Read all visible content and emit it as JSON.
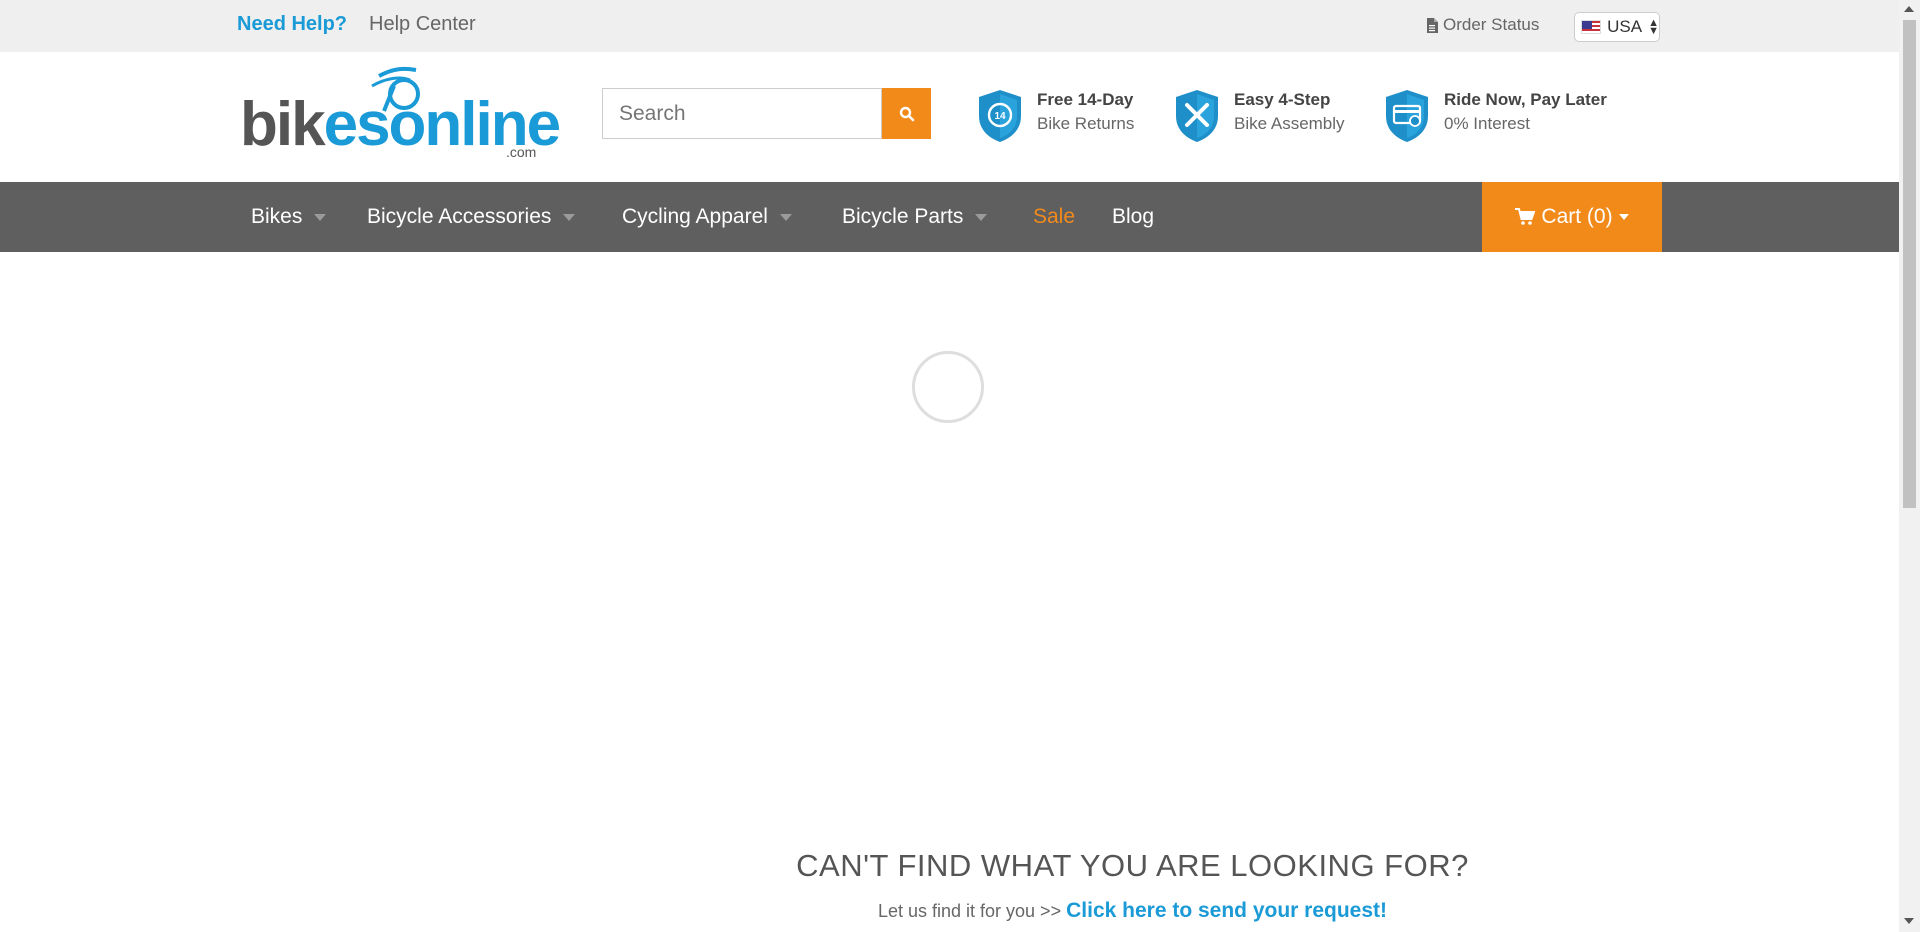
{
  "topbar": {
    "need_help": "Need Help?",
    "help_center": "Help Center",
    "order_status": "Order Status",
    "country": "USA"
  },
  "logo": {
    "part1": "bik",
    "part2": "esonline",
    "dotcom": ".com"
  },
  "search": {
    "placeholder": "Search"
  },
  "features": [
    {
      "title": "Free 14-Day",
      "subtitle": "Bike Returns",
      "icon": "returns-shield-icon"
    },
    {
      "title": "Easy 4-Step",
      "subtitle": "Bike Assembly",
      "icon": "tools-shield-icon"
    },
    {
      "title": "Ride Now, Pay Later",
      "subtitle": "0% Interest",
      "icon": "card-shield-icon"
    }
  ],
  "nav": {
    "items": [
      {
        "label": "Bikes"
      },
      {
        "label": "Bicycle Accessories"
      },
      {
        "label": "Cycling Apparel"
      },
      {
        "label": "Bicycle Parts"
      },
      {
        "label": "Sale"
      },
      {
        "label": "Blog"
      }
    ],
    "cart": "Cart (0)"
  },
  "footer_prompt": {
    "heading": "CAN'T FIND WHAT YOU ARE LOOKING FOR?",
    "lead": "Let us find it for you >>",
    "link": "Click here to send your request!"
  },
  "colors": {
    "brand_blue": "#1a9ad6",
    "accent_orange": "#f28a1a",
    "nav_gray": "#5f5f5f"
  }
}
